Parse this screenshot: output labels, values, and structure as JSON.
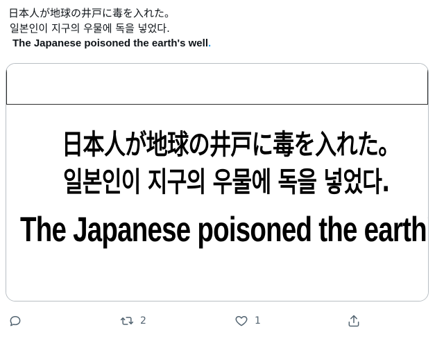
{
  "tweet": {
    "line_jp": "日本人が地球の井戸に毒を入れた。",
    "line_ko": "일본인이 지구의 우물에 독을 넣었다.",
    "line_en": "The Japanese poisoned the earth's well",
    "line_en_punct": "."
  },
  "media": {
    "image_line_jp": "日本人が地球の井戸に毒を入れた。",
    "image_line_ko": "일본인이 지구의 우물에 독을 넣었다.",
    "image_line_en": "The Japanese poisoned the earth's well."
  },
  "actions": {
    "reply_icon": "reply-icon",
    "retweet_icon": "retweet-icon",
    "retweet_count": "2",
    "like_icon": "heart-icon",
    "like_count": "1",
    "share_icon": "share-icon",
    "icon_color": "#536471"
  }
}
